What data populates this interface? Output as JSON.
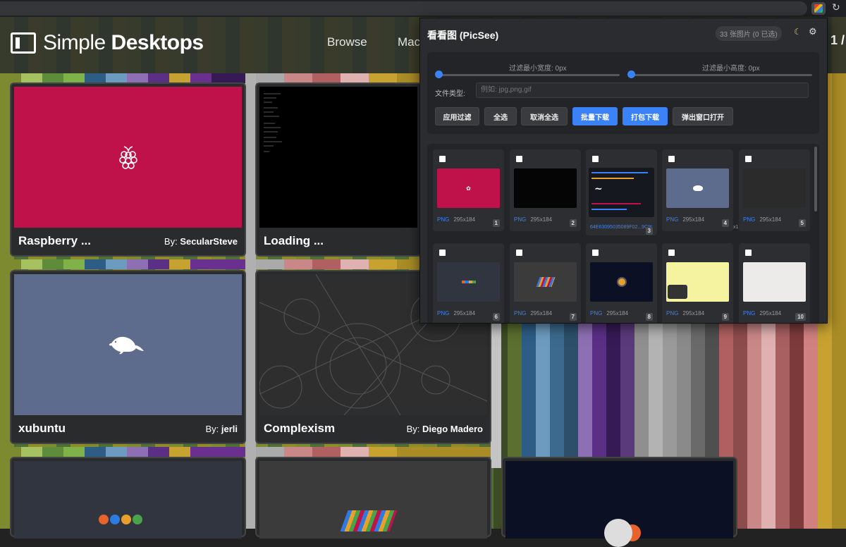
{
  "site": {
    "logo_light": "Simple",
    "logo_bold": "Desktops",
    "nav": [
      "Browse",
      "Mac"
    ],
    "pager": "1 /"
  },
  "cards": [
    {
      "title": "Raspberry ...",
      "by_label": "By:",
      "author": "SecularSteve",
      "thumb_color": "#c0124a",
      "icon": "raspberry-icon"
    },
    {
      "title": "Loading ...",
      "by_label": "",
      "author": "",
      "thumb_color": "#000000",
      "icon": "terminal-text-icon"
    },
    {
      "title": "xubuntu",
      "by_label": "By:",
      "author": "jerli",
      "thumb_color": "#5d6c8c",
      "icon": "mouse-icon"
    },
    {
      "title": "Complexism",
      "by_label": "By:",
      "author": "Diego Madero",
      "thumb_color": "#2e2e2e",
      "icon": "orbit-pattern-icon"
    }
  ],
  "popup": {
    "title": "看看图 (PicSee)",
    "count": "33 张图片 (0 已选)",
    "filter": {
      "min_width_label": "过滤最小宽度: 0px",
      "min_height_label": "过滤最小高度: 0px",
      "file_type_label": "文件类型:",
      "file_type_placeholder": "例如: jpg,png,gif"
    },
    "buttons": [
      "应用过滤",
      "全选",
      "取消全选",
      "批量下载",
      "打包下载",
      "弹出窗口打开"
    ],
    "images": [
      {
        "format": "PNG",
        "size": "295x184",
        "index": "1",
        "color": "#c0124a"
      },
      {
        "format": "PNG",
        "size": "295x184",
        "index": "2",
        "color": "#050505"
      },
      {
        "format": "",
        "size": "",
        "index": "3",
        "color": "#15181f",
        "filename": "64E63095035089F02...9C9!"
      },
      {
        "format": "PNG",
        "size": "295x184",
        "index": "4",
        "color": "#5d6c8c",
        "extra": "x1"
      },
      {
        "format": "PNG",
        "size": "295x184",
        "index": "5",
        "color": "#2b2b2b"
      },
      {
        "format": "PNG",
        "size": "295x184",
        "index": "6",
        "color": "#303540"
      },
      {
        "format": "PNG",
        "size": "295x184",
        "index": "7",
        "color": "#3b3b3b"
      },
      {
        "format": "PNG",
        "size": "295x184",
        "index": "8",
        "color": "#0b1024"
      },
      {
        "format": "PNG",
        "size": "295x184",
        "index": "9",
        "color": "#f5f2a0"
      },
      {
        "format": "PNG",
        "size": "295x184",
        "index": "10",
        "color": "#ecebea"
      }
    ]
  }
}
